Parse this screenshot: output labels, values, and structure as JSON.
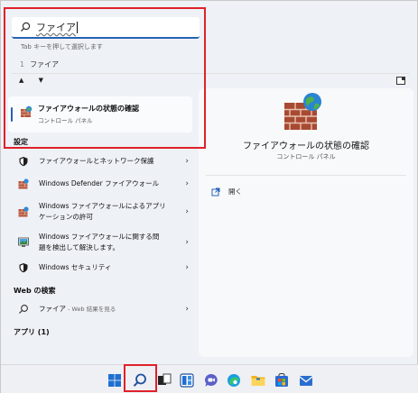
{
  "search": {
    "query": "ファイア",
    "hint": "Tab キーを押して選択します"
  },
  "ime": {
    "candidate_number": "1",
    "candidate_text": "ファイア",
    "arrows": "▲ ▼"
  },
  "best_match": {
    "title": "ファイアウォールの状態の確認",
    "subtitle": "コントロール パネル"
  },
  "settings": {
    "heading": "設定",
    "items": [
      {
        "label": "ファイアウォールとネットワーク保護",
        "icon": "shield-icon"
      },
      {
        "label": "Windows Defender ファイアウォール",
        "icon": "firewall-icon"
      },
      {
        "label_line1": "Windows ファイアウォールによるアプリ",
        "label_line2": "ケーションの許可",
        "icon": "firewall-icon"
      },
      {
        "label_line1": "Windows ファイアウォールに関する問",
        "label_line2": "題を検出して解決します。",
        "icon": "troubleshoot-icon"
      },
      {
        "label": "Windows セキュリティ",
        "icon": "shield-icon"
      }
    ]
  },
  "web": {
    "heading": "Web の検索",
    "query": "ファイア",
    "suffix": " - Web 結果を見る"
  },
  "apps": {
    "heading": "アプリ (1)"
  },
  "detail": {
    "title": "ファイアウォールの状態の確認",
    "subtitle": "コントロール パネル",
    "open_label": "開く"
  },
  "chevron": "›",
  "colors": {
    "accent": "#2463b4",
    "highlight": "#e0202a"
  },
  "taskbar": {
    "icons": [
      "windows-start-icon",
      "search-icon",
      "task-view-icon",
      "widgets-icon",
      "teams-chat-icon",
      "edge-icon",
      "file-explorer-icon",
      "store-icon",
      "mail-icon"
    ]
  }
}
